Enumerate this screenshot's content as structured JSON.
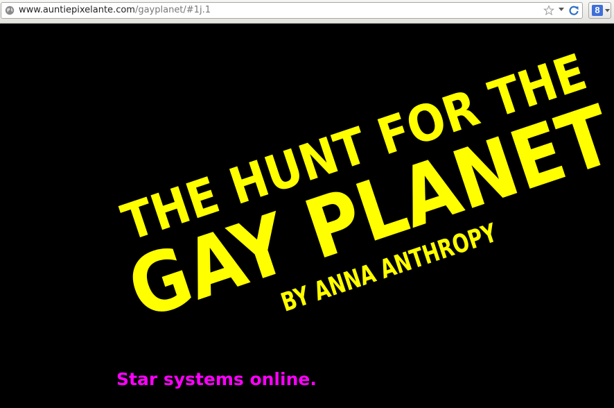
{
  "browser": {
    "url_host": "www.auntiepixelante.com",
    "url_path": "/gayplanet/#1j.1",
    "search_provider_icon": "g-icon",
    "search_provider_letter": "8"
  },
  "game": {
    "title_line1": "THE HUNT FOR THE",
    "title_line2": "GAY PLANET",
    "byline": "BY ANNA ANTHROPY",
    "status_text": "Star systems online.",
    "title_color": "#ffff00",
    "status_color": "#ff00ff",
    "background_color": "#000000"
  }
}
